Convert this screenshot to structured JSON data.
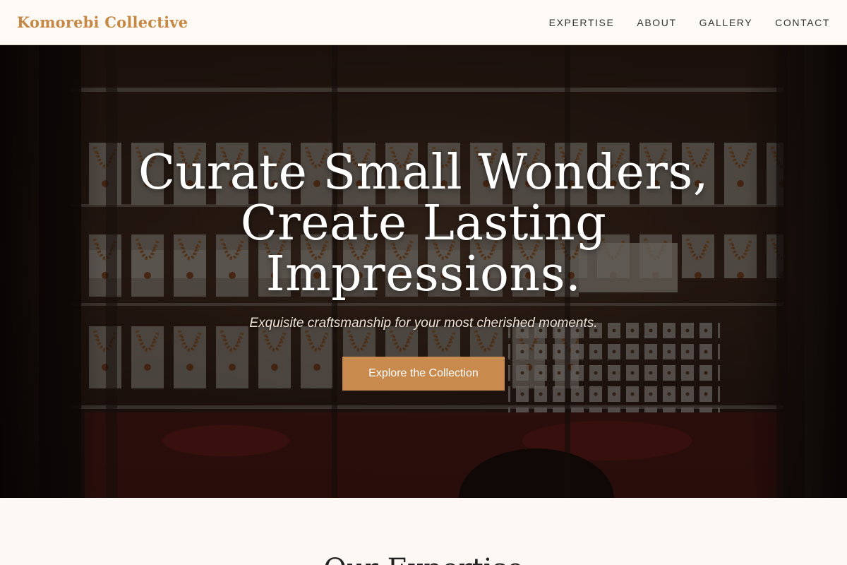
{
  "header": {
    "brand": "Komorebi Collective",
    "brand_color": "#c58845",
    "nav": [
      {
        "label": "EXPERTISE"
      },
      {
        "label": "ABOUT"
      },
      {
        "label": "GALLERY"
      },
      {
        "label": "CONTACT"
      }
    ]
  },
  "hero": {
    "title": "Curate Small Wonders, Create Lasting Impressions.",
    "subtitle": "Exquisite craftsmanship for your most cherished moments.",
    "cta_label": "Explore the Collection",
    "cta_color": "#c98a4d"
  },
  "expertise": {
    "title": "Our Expertise"
  }
}
